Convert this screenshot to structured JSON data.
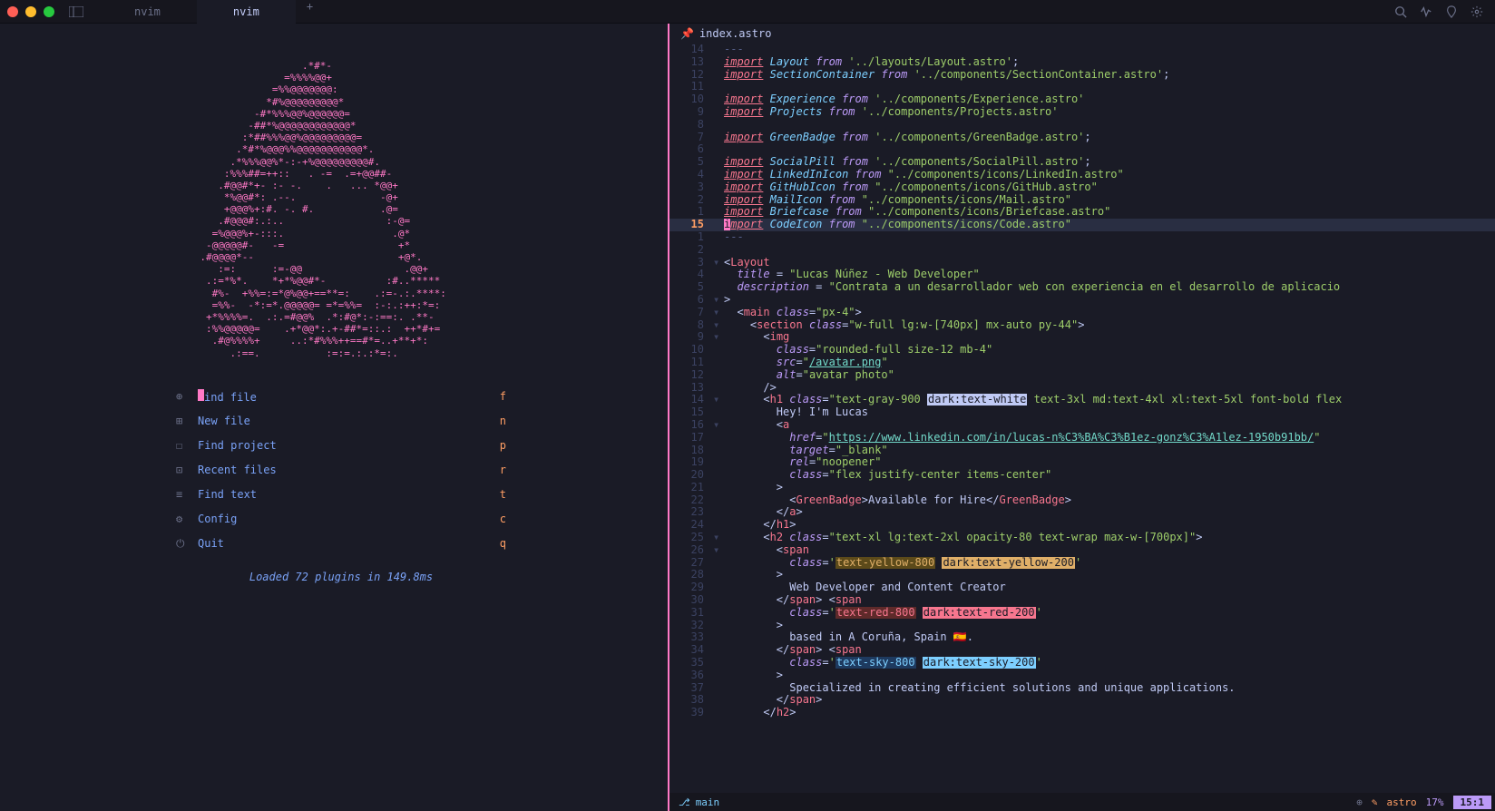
{
  "titlebar": {
    "tabs": [
      {
        "label": "nvim",
        "active": false
      },
      {
        "label": "nvim",
        "active": true
      }
    ]
  },
  "dashboard": {
    "ascii": "                  .*#*-                         \n               =%%%%@@+                         \n             =%%@@@@@@@:                        \n            *#%@@@@@@@@@*                       \n          -#*%%%@@%@@@@@@=                      \n         -##*%@@@@@@@@@@@@*                     \n        :*##%%%@@%@@@@@@@@@=                    \n       .*#*%@@@%%@@@@@@@@@@@*.                  \n      .*%%%@@%*-:-+%@@@@@@@@@#.                 \n     :%%%##=++::   . -=  .=+@@##-               \n    .#@@#*+- :- -.    .   ... *@@+              \n     *%@@#*: .--.              -@+              \n     +@@@%+:#. -. #.           .@=              \n    .#@@@#:.:..                 :-@=            \n   =%@@@%+-:::.                  .@*            \n  -@@@@@#-   -=                   +*            \n .#@@@@*--                        +@*.           \n    :=:      :=-@@                 .@@+          \n  .:=*%*.    *+*%@@#*-          :#..*****       \n   #%-  +%%=:=*@%@@+==**=:    .:=-.:.****:      \n   =%%-  -*:=*.@@@@@= =*=%%=  :-:.:++:*=:       \n  +*%%%%=.  .:.=#@@%  .*:#@*:-:==:. .**-        \n  :%%@@@@@=    .+*@@*:.+-##*=::.:  ++*#+=       \n   .#@%%%%+     ..:*#%%%++==#*=..+**+*:         \n      .:==.           :=:=.:.:*=:.              ",
    "menu": [
      {
        "icon": "⊕",
        "label": "ind file",
        "key": "f",
        "firstChar": "F"
      },
      {
        "icon": "⊞",
        "label": "New file",
        "key": "n"
      },
      {
        "icon": "☐",
        "label": "Find project",
        "key": "p"
      },
      {
        "icon": "⊡",
        "label": "Recent files",
        "key": "r"
      },
      {
        "icon": "≡",
        "label": "Find text",
        "key": "t"
      },
      {
        "icon": "⚙",
        "label": "Config",
        "key": "c"
      },
      {
        "icon": "⏻",
        "label": "Quit",
        "key": "q"
      }
    ],
    "footer": "Loaded 72 plugins in 149.8ms"
  },
  "editor": {
    "filename": "index.astro",
    "gutterNumbers": [
      "14",
      "13",
      "12",
      "11",
      "10",
      "9",
      "8",
      "7",
      "6",
      "5",
      "4",
      "3",
      "2",
      "1",
      "15",
      "1",
      "2",
      "3",
      "4",
      "5",
      "6",
      "7",
      "8",
      "9",
      "10",
      "11",
      "12",
      "13",
      "14",
      "15",
      "16",
      "17",
      "18",
      "19",
      "20",
      "21",
      "22",
      "23",
      "24",
      "25",
      "26",
      "27",
      "28",
      "29",
      "30",
      "31",
      "32",
      "33",
      "34",
      "35",
      "36",
      "37",
      "38",
      "39"
    ],
    "statusline": {
      "branch": "main",
      "filetype": "astro",
      "percent": "17%",
      "pos": "15:1"
    }
  }
}
